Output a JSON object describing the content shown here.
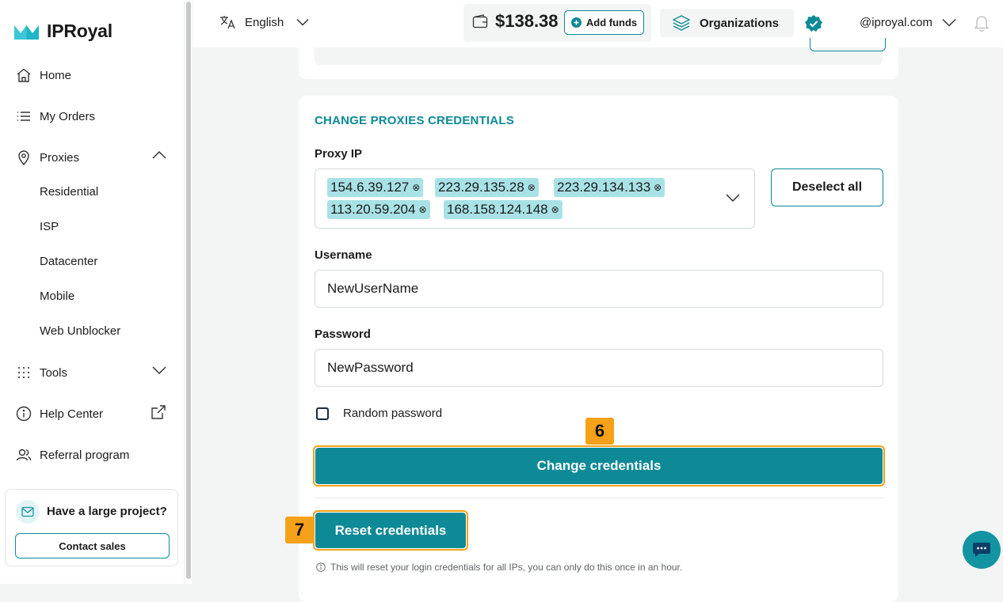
{
  "brand": {
    "name": "IPRoyal"
  },
  "sidebar": {
    "items": [
      {
        "label": "Home",
        "icon": "home-icon"
      },
      {
        "label": "My Orders",
        "icon": "list-icon"
      },
      {
        "label": "Proxies",
        "icon": "location-pin-icon",
        "expanded": true
      },
      {
        "label": "Tools",
        "icon": "grid-dots-icon",
        "expanded": false
      },
      {
        "label": "Help Center",
        "icon": "info-icon"
      },
      {
        "label": "Referral program",
        "icon": "users-icon"
      }
    ],
    "proxy_subitems": [
      "Residential",
      "ISP",
      "Datacenter",
      "Mobile",
      "Web Unblocker"
    ],
    "promo": {
      "title": "Have a large project?",
      "button": "Contact sales"
    }
  },
  "header": {
    "language": "English",
    "balance": "$138.38",
    "add_funds": "Add funds",
    "organizations": "Organizations",
    "account": "@iproyal.com"
  },
  "form": {
    "section_title": "CHANGE PROXIES CREDENTIALS",
    "proxy_ip_label": "Proxy IP",
    "selected_ips": [
      "154.6.39.127",
      "223.29.135.28",
      "223.29.134.133",
      "113.20.59.204",
      "168.158.124.148"
    ],
    "deselect_all": "Deselect all",
    "username_label": "Username",
    "username_value": "NewUserName",
    "password_label": "Password",
    "password_value": "NewPassword",
    "random_password_label": "Random password",
    "random_password_checked": false,
    "change_button": "Change credentials",
    "reset_button": "Reset credentials",
    "reset_note": "This will reset your login credentials for all IPs, you can only do this once in an hour."
  },
  "annotations": {
    "change_step": "6",
    "reset_step": "7"
  },
  "colors": {
    "accent": "#0d8a96",
    "highlight": "#f5a11a",
    "chip": "#a8e2e6"
  }
}
